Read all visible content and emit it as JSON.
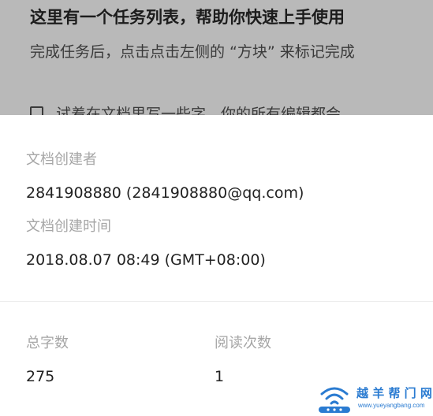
{
  "document": {
    "title": "这里有一个任务列表，帮助你快速上手使用",
    "paragraph": "完成任务后，点击点击左侧的 “方块” 来标记完成",
    "task_item": "试着在文档里写一些字，你的所有编辑都会"
  },
  "info": {
    "creator_label": "文档创建者",
    "creator_value": "2841908880  (2841908880@qq.com)",
    "created_time_label": "文档创建时间",
    "created_time_value": "2018.08.07 08:49 (GMT+08:00)",
    "word_count_label": "总字数",
    "word_count_value": "275",
    "read_count_label": "阅读次数",
    "read_count_value": "1"
  },
  "watermark": {
    "name": "越 羊 帮 门 网",
    "url": "www.yueyangbang.com"
  },
  "colors": {
    "overlay": "#b9b9b9",
    "label": "#a6a6a6",
    "value": "#222222",
    "watermark": "#2a7bd1"
  }
}
